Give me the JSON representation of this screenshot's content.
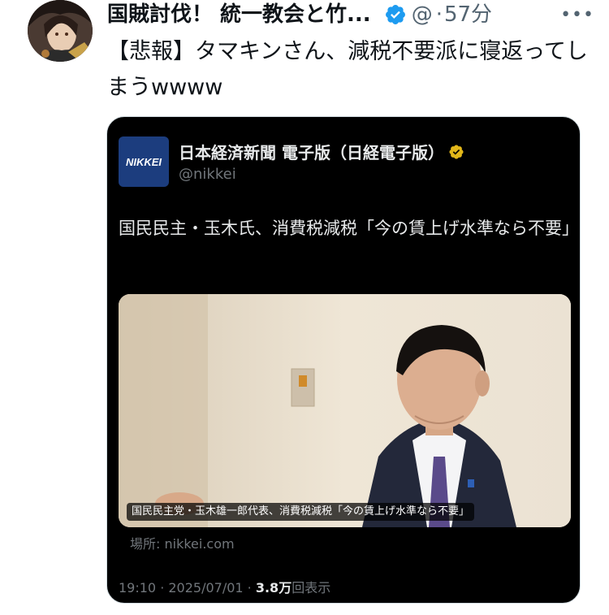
{
  "author": {
    "display_name": "国賊討伐！ 統一教会と竹...",
    "handle": "@",
    "separator": "·",
    "time": "57分"
  },
  "tweet": {
    "text": "【悲報】タマキンさん、減税不要派に寝返ってしまうwwww"
  },
  "quote": {
    "logo_text": "NIKKEI",
    "name": "日本経済新聞 電子版（日経電子版）",
    "handle": "@nikkei",
    "text": "国民民主・玉木氏、消費税減税「今の賃上げ水準なら不要」",
    "image_caption": "国民民主党・玉木雄一郎代表、消費税減税「今の賃上げ水準なら不要」",
    "source": "場所: nikkei.com",
    "timestamp": "19:10 · 2025/07/01 · ",
    "views_count": "3.8万",
    "views_label": "回表示"
  },
  "colors": {
    "verified_blue": "#1d9bf0",
    "verified_gold": "#e2b719",
    "nikkei_blue": "#1c3d7e"
  },
  "icons": [
    "avatar-image",
    "verified-badge-icon",
    "more-icon",
    "gold-verified-badge-icon"
  ]
}
